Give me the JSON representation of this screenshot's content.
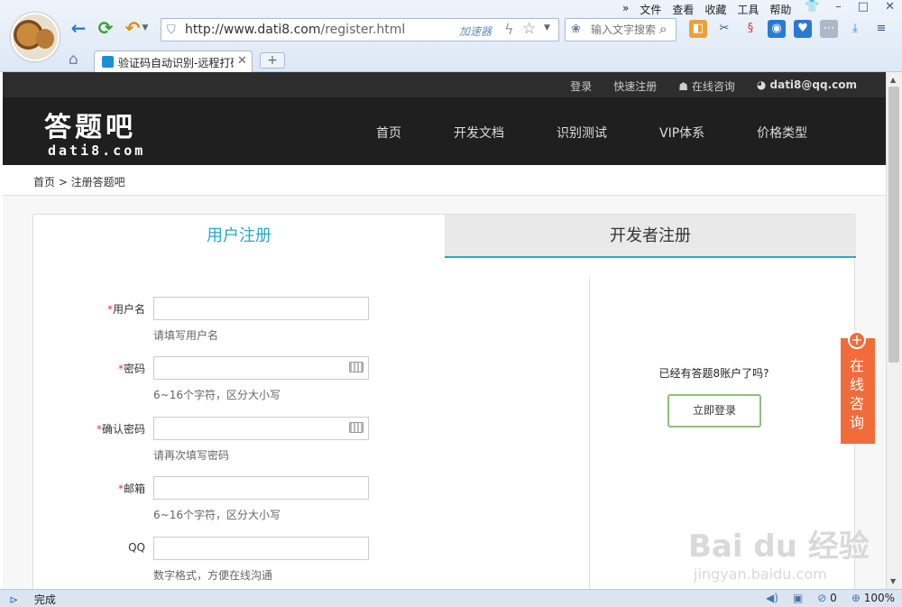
{
  "browser": {
    "url_host": "http://www.dati8.com",
    "url_path": "/register.html",
    "accelerator_label": "加速器",
    "search_placeholder": "输入文字搜索",
    "menu": [
      "文件",
      "查看",
      "收藏",
      "工具",
      "帮助"
    ],
    "tab_title": "验证码自动识别-远程打码平台",
    "new_tab_label": "+",
    "status_text": "完成",
    "status_zero": "0",
    "zoom": "100%"
  },
  "site": {
    "top_links": [
      "登录",
      "快速注册",
      "在线咨询",
      "dati8@qq.com"
    ],
    "logo_cn": "答题吧",
    "logo_en": "dati8.com",
    "nav": [
      "首页",
      "开发文档",
      "识别测试",
      "VIP体系",
      "价格类型"
    ],
    "breadcrumb": "首页 > 注册答题吧"
  },
  "register": {
    "tab_user": "用户注册",
    "tab_dev": "开发者注册",
    "fields": [
      {
        "label": "用户名",
        "required": "*",
        "hint": "请填写用户名"
      },
      {
        "label": "密码",
        "required": "*",
        "hint": "6~16个字符，区分大小写"
      },
      {
        "label": "确认密码",
        "required": "*",
        "hint": "请再次填写密码"
      },
      {
        "label": "邮箱",
        "required": "*",
        "hint": "6~16个字符，区分大小写"
      },
      {
        "label": "QQ",
        "required": "",
        "hint": "数字格式，方便在线沟通"
      }
    ],
    "have_account": "已经有答题8账户了吗?",
    "login_now": "立即登录"
  },
  "float_consult": {
    "plus": "+",
    "text": "在线咨询"
  },
  "watermark": {
    "main": "Bai du 经验",
    "sub": "jingyan.baidu.com"
  }
}
